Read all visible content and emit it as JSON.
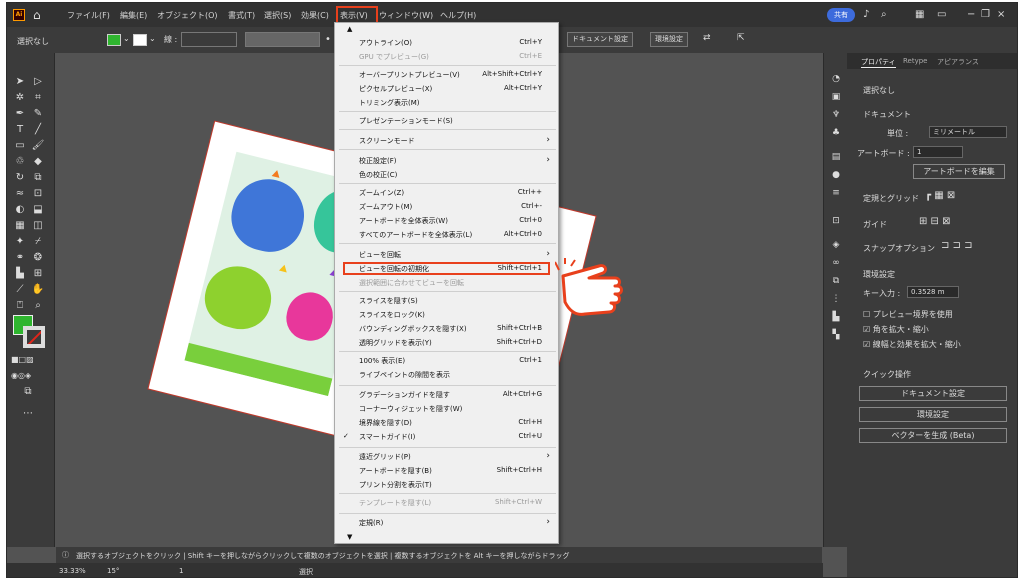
{
  "app": {
    "logo": "Ai"
  },
  "menubar": {
    "items": [
      "ファイル(F)",
      "編集(E)",
      "オブジェクト(O)",
      "書式(T)",
      "選択(S)",
      "効果(C)",
      "表示(V)",
      "ウィンドウ(W)",
      "ヘルプ(H)"
    ],
    "share": "共有"
  },
  "control": {
    "selection": "選択なし",
    "stroke_label": "線 :",
    "doc_setup": "ドキュメント設定",
    "env_setup": "環境設定"
  },
  "view_menu": {
    "items": [
      {
        "label": "アウトライン(O)",
        "shortcut": "Ctrl+Y"
      },
      {
        "label": "GPU でプレビュー(G)",
        "shortcut": "Ctrl+E",
        "disabled": true
      },
      {
        "label": "オーバープリントプレビュー(V)",
        "shortcut": "Alt+Shift+Ctrl+Y"
      },
      {
        "label": "ピクセルプレビュー(X)",
        "shortcut": "Alt+Ctrl+Y"
      },
      {
        "label": "トリミング表示(M)",
        "shortcut": ""
      },
      {
        "label": "プレゼンテーションモード(S)",
        "shortcut": ""
      },
      {
        "label": "スクリーンモード",
        "shortcut": ""
      },
      {
        "label": "校正設定(F)",
        "shortcut": ""
      },
      {
        "label": "色の校正(C)",
        "shortcut": ""
      },
      {
        "label": "ズームイン(Z)",
        "shortcut": "Ctrl++"
      },
      {
        "label": "ズームアウト(M)",
        "shortcut": "Ctrl+-"
      },
      {
        "label": "アートボードを全体表示(W)",
        "shortcut": "Ctrl+0"
      },
      {
        "label": "すべてのアートボードを全体表示(L)",
        "shortcut": "Alt+Ctrl+0"
      },
      {
        "label": "ビューを回転",
        "shortcut": ""
      },
      {
        "label": "ビューを回転の初期化",
        "shortcut": "Shift+Ctrl+1"
      },
      {
        "label": "選択範囲に合わせてビューを回転",
        "shortcut": "",
        "disabled": true
      },
      {
        "label": "スライスを隠す(S)",
        "shortcut": ""
      },
      {
        "label": "スライスをロック(K)",
        "shortcut": ""
      },
      {
        "label": "バウンディングボックスを隠す(X)",
        "shortcut": "Shift+Ctrl+B"
      },
      {
        "label": "透明グリッドを表示(Y)",
        "shortcut": "Shift+Ctrl+D"
      },
      {
        "label": "100% 表示(E)",
        "shortcut": "Ctrl+1"
      },
      {
        "label": "ライブペイントの隙間を表示",
        "shortcut": ""
      },
      {
        "label": "グラデーションガイドを隠す",
        "shortcut": "Alt+Ctrl+G"
      },
      {
        "label": "コーナーウィジェットを隠す(W)",
        "shortcut": ""
      },
      {
        "label": "境界線を隠す(D)",
        "shortcut": "Ctrl+H"
      },
      {
        "label": "スマートガイド(I)",
        "shortcut": "Ctrl+U",
        "checked": true
      },
      {
        "label": "遠近グリッド(P)",
        "shortcut": ""
      },
      {
        "label": "アートボードを隠す(B)",
        "shortcut": "Shift+Ctrl+H"
      },
      {
        "label": "プリント分割を表示(T)",
        "shortcut": ""
      },
      {
        "label": "テンプレートを隠す(L)",
        "shortcut": "Shift+Ctrl+W",
        "disabled": true
      },
      {
        "label": "定規(R)",
        "shortcut": ""
      }
    ]
  },
  "panel": {
    "tabs": [
      "プロパティ",
      "Retype",
      "アピアランス"
    ],
    "no_selection": "選択なし",
    "document": "ドキュメント",
    "unit_label": "単位 :",
    "unit_value": "ミリメートル",
    "artboard_label": "アートボード :",
    "artboard_value": "1",
    "edit_artboard": "アートボードを編集",
    "rulers_grids": "定規とグリッド",
    "guides": "ガイド",
    "snap_options": "スナップオプション",
    "prefs": "環境設定",
    "key_input_label": "キー入力 :",
    "key_input_value": "0.3528 m",
    "preview_bounds": "プレビュー境界を使用",
    "scale_corners": "角を拡大・縮小",
    "scale_strokes": "線幅と効果を拡大・縮小",
    "quick_actions": "クイック操作",
    "qa_doc_setup": "ドキュメント設定",
    "qa_prefs": "環境設定",
    "qa_vectorize": "ベクターを生成 (Beta)"
  },
  "status": {
    "hint": "選択するオブジェクトをクリック | Shift キーを押しながらクリックして複数のオブジェクトを選択 | 複数するオブジェクトを Alt キーを押しながらドラッグ",
    "zoom": "33.33%",
    "rotation": "15°",
    "artboard_num": "1",
    "tool_name": "選択"
  },
  "colors": {
    "accent_red": "#e8401c",
    "fill_green": "#2fb52f",
    "share_blue": "#3d6bdc"
  }
}
